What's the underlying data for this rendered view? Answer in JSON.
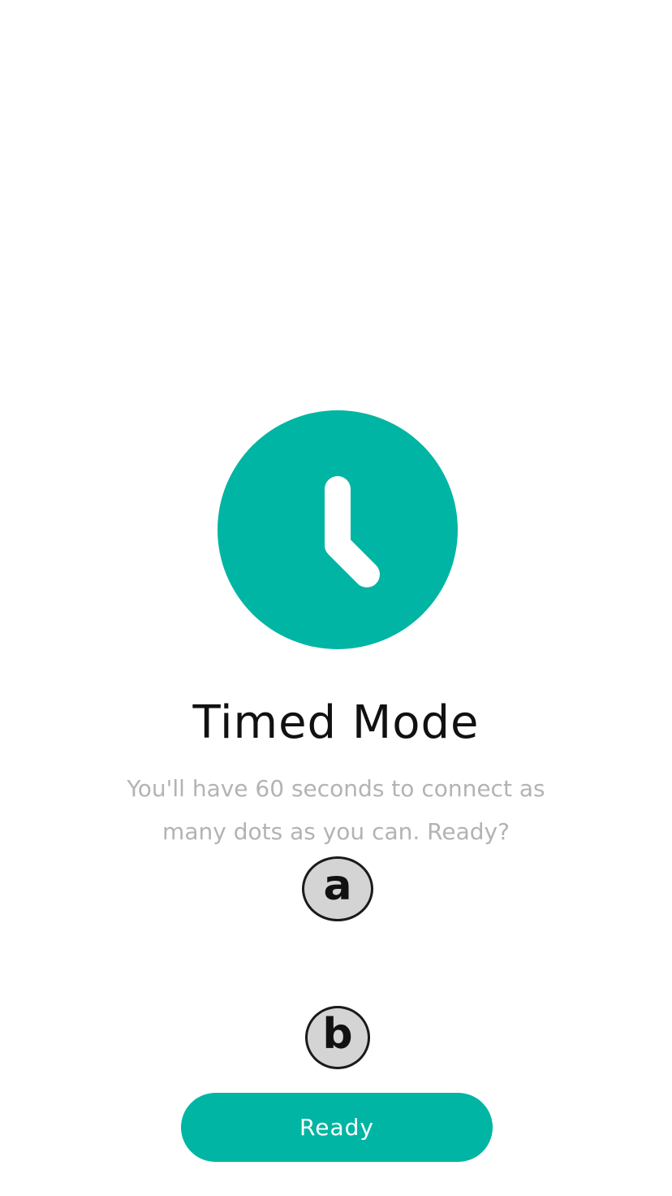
{
  "theme": {
    "accent": "#00b5a3",
    "title_color": "#111111",
    "subtitle_color": "#b3b3b3",
    "background": "#ffffff"
  },
  "hero": {
    "icon": "clock-icon"
  },
  "title": "Timed Mode",
  "description": "You'll have 60 seconds to connect as many dots as you can. Ready?",
  "annotations": {
    "a": "a",
    "b": "b"
  },
  "buttons": {
    "ready_label": "Ready"
  }
}
